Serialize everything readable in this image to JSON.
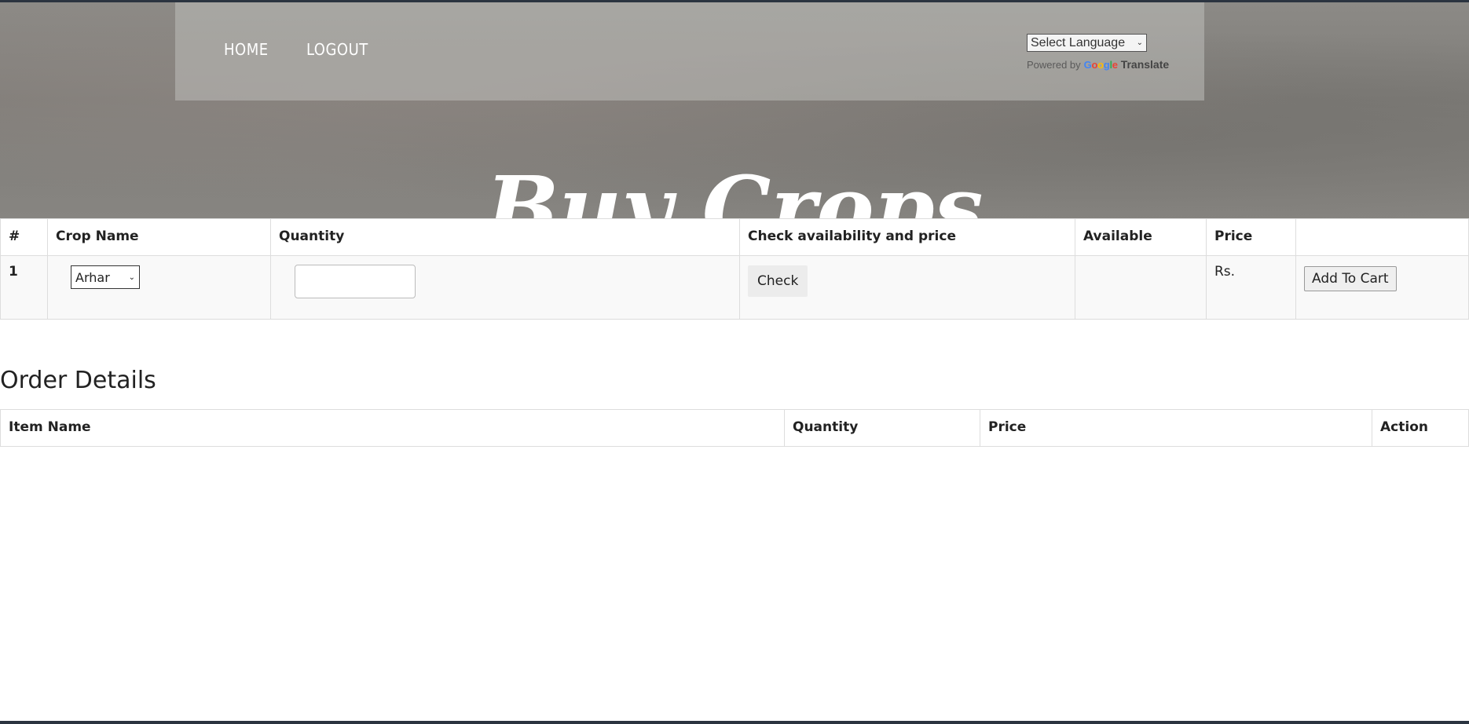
{
  "nav": {
    "home": "HOME",
    "logout": "LOGOUT"
  },
  "translate": {
    "select_label": "Select Language",
    "powered_by": "Powered by",
    "google": [
      "G",
      "o",
      "o",
      "g",
      "l",
      "e"
    ],
    "translate": "Translate"
  },
  "hero": {
    "title": "Buy Crops"
  },
  "crop_table": {
    "headers": [
      "#",
      "Crop Name",
      "Quantity",
      "Check availability and price",
      "Available",
      "Price",
      ""
    ],
    "rows": [
      {
        "index": "1",
        "crop": "Arhar",
        "quantity": "",
        "check_label": "Check",
        "available": "",
        "price": "Rs.",
        "cart_label": "Add To Cart"
      }
    ]
  },
  "order": {
    "heading": "Order Details",
    "headers": [
      "Item Name",
      "Quantity",
      "Price",
      "Action"
    ]
  },
  "colors": {
    "frame": "#2b3440",
    "hero_bg": "#878581",
    "text": "#222222"
  },
  "icons": {
    "dropdown": "chevron-down-icon"
  }
}
